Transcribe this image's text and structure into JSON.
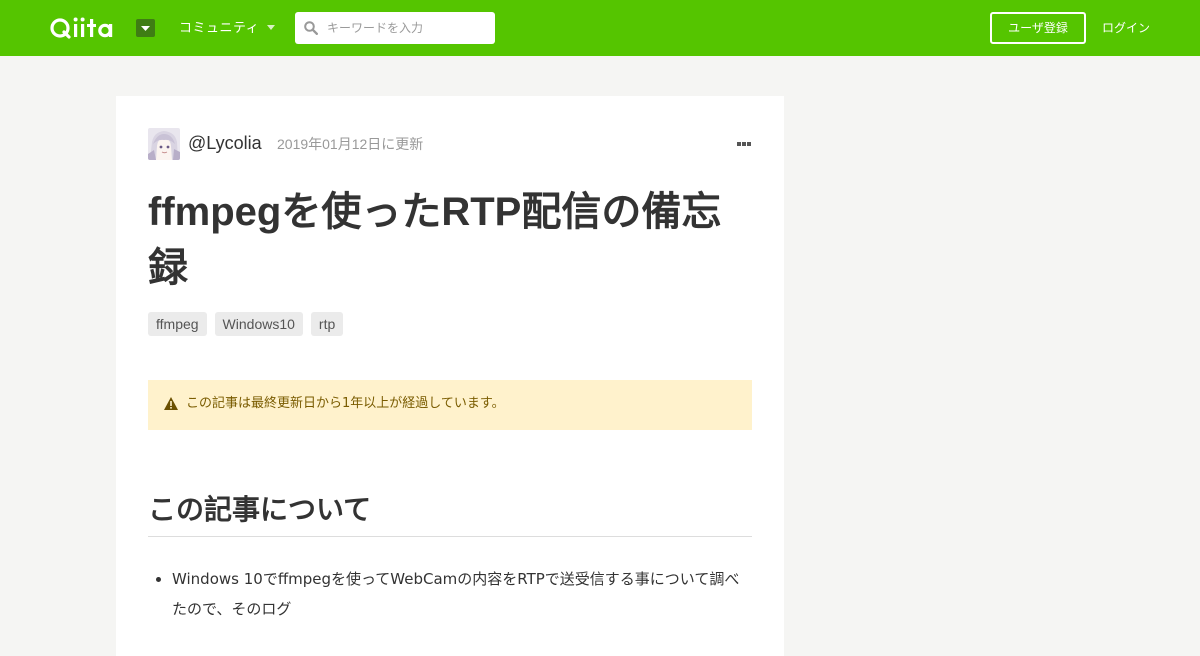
{
  "header": {
    "logo_text": "Qiita",
    "community_label": "コミュニティ",
    "search": {
      "placeholder": "キーワードを入力",
      "value": ""
    },
    "signup_label": "ユーザ登録",
    "login_label": "ログイン",
    "brand_color": "#55c500"
  },
  "article": {
    "author": "@Lycolia",
    "updated": "2019年01月12日に更新",
    "title": "ffmpegを使ったRTP配信の備忘録",
    "tags": [
      "ffmpeg",
      "Windows10",
      "rtp"
    ],
    "alert": {
      "text": "この記事は最終更新日から1年以上が経過しています。",
      "icon": "warning-icon",
      "background": "#fff2cc"
    },
    "section_heading": "この記事について",
    "bullets": [
      "Windows 10でffmpegを使ってWebCamの内容をRTPで送受信する事について調べたので、そのログ"
    ]
  },
  "icons": {
    "logo_menu": "caret-down-icon",
    "community_menu": "caret-down-icon",
    "search": "search-icon",
    "more": "more-horizontal-icon",
    "avatar": "avatar-image"
  }
}
